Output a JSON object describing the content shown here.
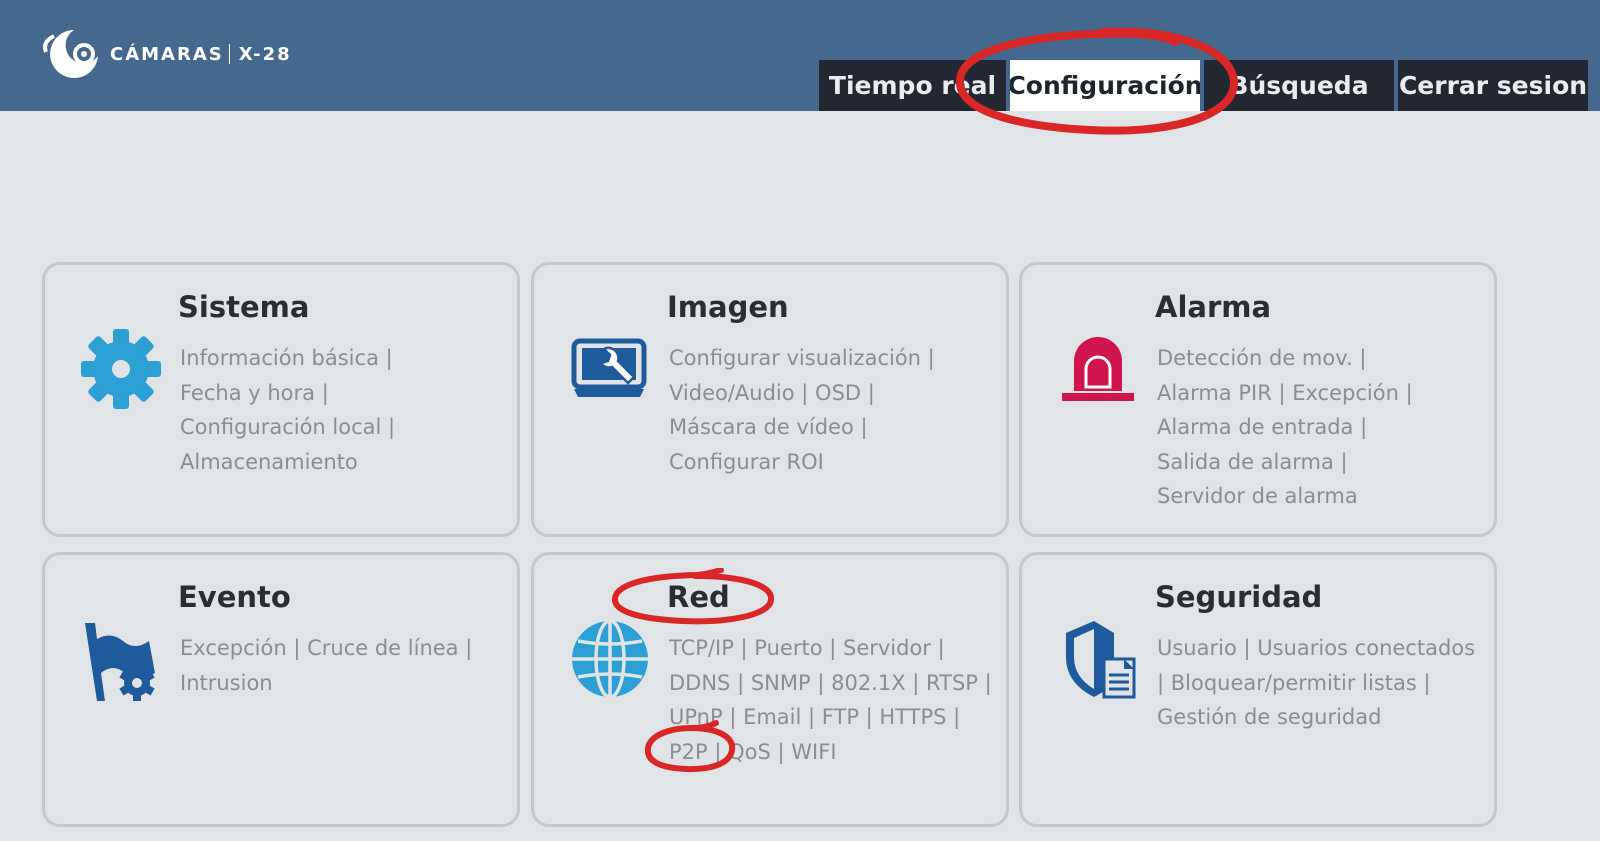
{
  "logo": {
    "brand": "CÁMARAS",
    "model": "X-28"
  },
  "nav": {
    "tabs": [
      {
        "label": "Tiempo real",
        "active": false
      },
      {
        "label": "Configuración",
        "active": true
      },
      {
        "label": "Búsqueda",
        "active": false
      },
      {
        "label": "Cerrar sesion",
        "active": false
      }
    ]
  },
  "cards": {
    "sistema": {
      "title": "Sistema",
      "links": [
        "Información básica",
        "Fecha y hora",
        "Configuración local",
        "Almacenamiento"
      ]
    },
    "imagen": {
      "title": "Imagen",
      "links": [
        "Configurar visualización",
        "Video/Audio",
        "OSD",
        "Máscara de vídeo",
        "Configurar ROI"
      ]
    },
    "alarma": {
      "title": "Alarma",
      "links": [
        "Detección de mov.",
        "Alarma PIR",
        "Excepción",
        "Alarma de entrada",
        "Salida de alarma",
        "Servidor de alarma"
      ]
    },
    "evento": {
      "title": "Evento",
      "links": [
        "Excepción",
        "Cruce de línea",
        "Intrusion"
      ]
    },
    "red": {
      "title": "Red",
      "links": [
        "TCP/IP",
        "Puerto",
        "Servidor",
        "DDNS",
        "SNMP",
        "802.1X",
        "RTSP",
        "UPnP",
        "Email",
        "FTP",
        "HTTPS",
        "P2P",
        "QoS",
        "WIFI"
      ]
    },
    "seguridad": {
      "title": "Seguridad",
      "links": [
        "Usuario",
        "Usuarios conectados",
        "Bloquear/permitir listas",
        "Gestión de seguridad"
      ]
    }
  },
  "colors": {
    "header": "#45688f",
    "tab_dark": "#222731",
    "icon_blue": "#2c9fd4",
    "icon_navy": "#1e5a9c",
    "alarm_red": "#d0144f",
    "annotation_red": "#d92626"
  }
}
